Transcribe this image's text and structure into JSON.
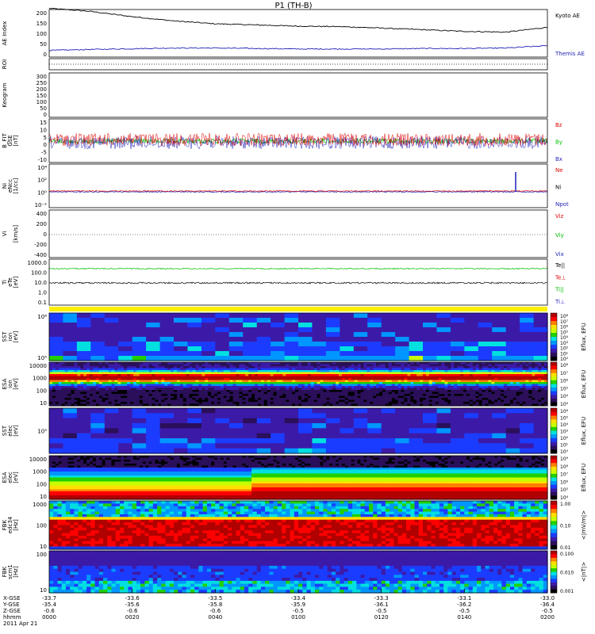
{
  "title": "P1 (TH-B)",
  "chart_data": [
    {
      "type": "line",
      "panel": "ae",
      "ylabel": "AE Index",
      "yticks": [
        "200",
        "150",
        "100",
        "50",
        "0"
      ],
      "ylim": [
        0,
        200
      ],
      "x": [
        0,
        10,
        20,
        30,
        40,
        50,
        60,
        70,
        80,
        90,
        100,
        110,
        120
      ],
      "series": [
        {
          "name": "Kyoto AE",
          "color": "#000000",
          "values": [
            205,
            192,
            170,
            152,
            140,
            135,
            130,
            128,
            122,
            115,
            108,
            105,
            125
          ]
        },
        {
          "name": "Themis AE",
          "color": "#1f1fb5",
          "values": [
            28,
            32,
            35,
            38,
            38,
            36,
            34,
            34,
            34,
            36,
            36,
            38,
            48
          ]
        }
      ]
    },
    {
      "type": "line",
      "panel": "roi",
      "ylabel": "ROI",
      "yticks": []
    },
    {
      "type": "line",
      "panel": "keogram",
      "ylabel": "Keogram",
      "yticks": [
        "300",
        "250",
        "200",
        "150",
        "100",
        "50",
        "0"
      ]
    },
    {
      "type": "line",
      "panel": "bfield",
      "ylabel": "B_FIT",
      "ylabel2": "GSE",
      "ylabel3": "[nT]",
      "yticks": [
        "15",
        "10",
        "5",
        "0",
        "-5",
        "-10"
      ],
      "ylim": [
        -10,
        15
      ],
      "series": [
        {
          "name": "Bz",
          "color": "#e00000"
        },
        {
          "name": "By",
          "color": "#00c000"
        },
        {
          "name": "Bx",
          "color": "#1f1fb5"
        }
      ]
    },
    {
      "type": "line",
      "panel": "density",
      "ylabel": "Ni",
      "ylabel2": "eNcc",
      "ylabel3": "[1/cc]",
      "yticks": [
        "10⁴",
        "10²",
        "10⁰",
        "10⁻²"
      ],
      "series": [
        {
          "name": "Ne",
          "color": "#e00000"
        },
        {
          "name": "Ni",
          "color": "#000000"
        },
        {
          "name": "Npot",
          "color": "#1f1fb5"
        }
      ]
    },
    {
      "type": "line",
      "panel": "velocity",
      "ylabel": "Vi",
      "ylabel3": "[km/s]",
      "yticks": [
        "400",
        "200",
        "0",
        "-200",
        "-400"
      ],
      "series": [
        {
          "name": "Viz",
          "color": "#e00000"
        },
        {
          "name": "Viy",
          "color": "#00c000"
        },
        {
          "name": "Vix",
          "color": "#1f1fb5"
        }
      ]
    },
    {
      "type": "line",
      "panel": "temperature",
      "ylabel": "Ti",
      "ylabel2": "eTe",
      "ylabel3": "[eV]",
      "yticks": [
        "1000.0",
        "100.0",
        "10.0",
        "1.0",
        "0.1"
      ],
      "series": [
        {
          "name": "Te||",
          "color": "#000000"
        },
        {
          "name": "Te⊥",
          "color": "#e00000"
        },
        {
          "name": "Ti||",
          "color": "#00c000"
        },
        {
          "name": "Ti⊥",
          "color": "#1f1fb5"
        }
      ]
    },
    {
      "type": "heatmap",
      "panel": "sst-ion",
      "ylabel": "SST",
      "ylabel2": "ion",
      "ylabel3": "[eV]",
      "yticks": [
        "10⁶",
        "10⁵"
      ],
      "colorbar": [
        "10⁸",
        "10⁷",
        "10⁶",
        "10⁵",
        "10⁴",
        "10³",
        "10²",
        "10¹",
        "10⁰"
      ],
      "zlabel": "Eflux, EFU"
    },
    {
      "type": "heatmap",
      "panel": "esa-ion",
      "ylabel": "ESA",
      "ylabel2": "ion",
      "ylabel3": "[eV]",
      "yticks": [
        "10000",
        "1000",
        "100",
        "10"
      ],
      "colorbar": [
        "10⁸",
        "10⁷",
        "10⁶",
        "10⁵",
        "10⁴",
        "10³"
      ],
      "zlabel": "Eflux, EFU"
    },
    {
      "type": "heatmap",
      "panel": "sst-elec",
      "ylabel": "SST",
      "ylabel2": "elec",
      "ylabel3": "[eV]",
      "yticks": [
        "10⁵"
      ],
      "colorbar": [
        "10⁶",
        "10⁵",
        "10⁴",
        "10³",
        "10²",
        "10¹",
        "10⁰"
      ],
      "zlabel": "Eflux, EFU"
    },
    {
      "type": "heatmap",
      "panel": "esa-elec",
      "ylabel": "ESA",
      "ylabel2": "elec",
      "ylabel3": "[eV]",
      "yticks": [
        "10000",
        "1000",
        "100",
        "10"
      ],
      "colorbar": [
        "10⁹",
        "10⁸",
        "10⁷",
        "10⁶",
        "10⁵",
        "10⁴"
      ],
      "zlabel": "Eflux, EFU"
    },
    {
      "type": "heatmap",
      "panel": "fbk-e",
      "ylabel": "FBK",
      "ylabel2": "edc34",
      "ylabel3": "[Hz]",
      "yticks": [
        "1000",
        "100",
        "10"
      ],
      "colorbar": [
        "1.00",
        "0.10",
        "0.01"
      ],
      "zlabel": "<|mV/m|>"
    },
    {
      "type": "heatmap",
      "panel": "fbk-b",
      "ylabel": "FBK",
      "ylabel2": "scm1",
      "ylabel3": "[Hz]",
      "yticks": [
        "100",
        "10"
      ],
      "colorbar": [
        "0.100",
        "0.010",
        "0.001"
      ],
      "zlabel": "<|nT|>"
    }
  ],
  "footer": {
    "row_labels": [
      "X-GSE",
      "Y-GSE",
      "Z-GSE",
      "hhmm",
      "2011 Apr 21"
    ],
    "columns": [
      {
        "x": "-33.7",
        "y": "-35.4",
        "z": "-0.6",
        "t": "0000"
      },
      {
        "x": "-33.6",
        "y": "-35.6",
        "z": "-0.6",
        "t": "0020"
      },
      {
        "x": "-33.5",
        "y": "-35.8",
        "z": "-0.6",
        "t": "0040"
      },
      {
        "x": "-33.4",
        "y": "-35.9",
        "z": "-0.5",
        "t": "0100"
      },
      {
        "x": "-33.3",
        "y": "-36.1",
        "z": "-0.5",
        "t": "0120"
      },
      {
        "x": "-33.1",
        "y": "-36.2",
        "z": "-0.5",
        "t": "0140"
      },
      {
        "x": "-33.0",
        "y": "-36.4",
        "z": "-0.5",
        "t": "0200"
      }
    ]
  }
}
